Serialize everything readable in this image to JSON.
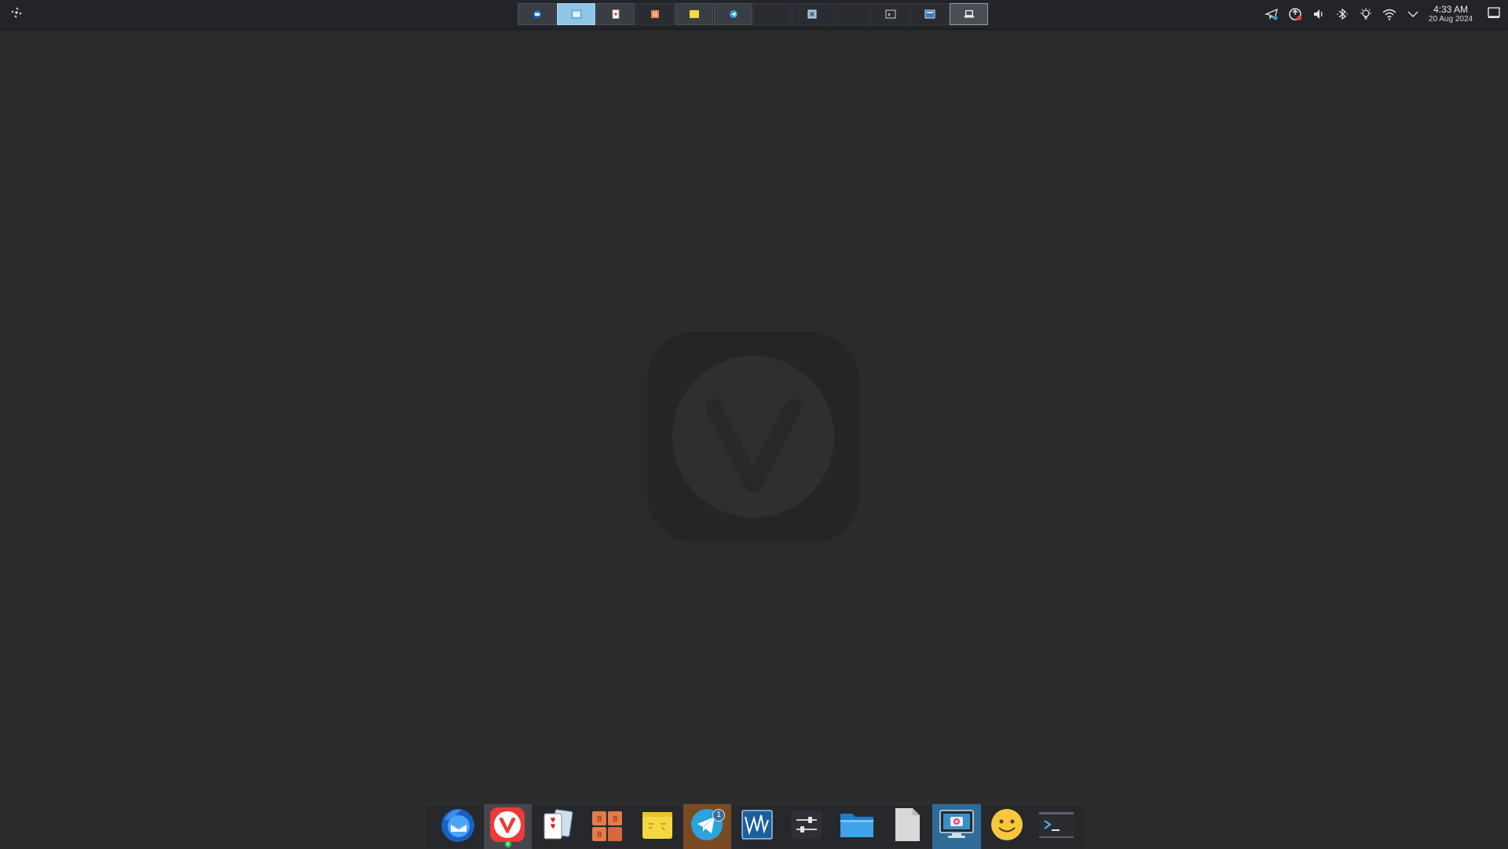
{
  "top_panel": {
    "launcher_icon": "launcher-arrows-icon",
    "virtual_desktops": [
      {
        "name": "desktop-1",
        "icon": "thunderbird-mini-icon",
        "state": "filled"
      },
      {
        "name": "desktop-2",
        "icon": "window-mini-icon",
        "state": "active"
      },
      {
        "name": "desktop-3",
        "icon": "cards-mini-icon",
        "state": "filled"
      },
      {
        "name": "desktop-4",
        "icon": "mahjong-mini-icon",
        "state": "empty"
      },
      {
        "name": "desktop-5",
        "icon": "notes-mini-icon",
        "state": "filled"
      },
      {
        "name": "desktop-6",
        "icon": "telegram-mini-icon",
        "state": "filled"
      },
      {
        "name": "desktop-7",
        "icon": "",
        "state": "empty"
      },
      {
        "name": "desktop-8",
        "icon": "app-mini-icon",
        "state": "empty"
      },
      {
        "name": "desktop-9",
        "icon": "",
        "state": "empty"
      },
      {
        "name": "desktop-10",
        "icon": "terminal-mini-icon",
        "state": "empty"
      },
      {
        "name": "desktop-11",
        "icon": "window-blue-mini-icon",
        "state": "empty"
      },
      {
        "name": "desktop-12",
        "icon": "laptop-mini-icon",
        "state": "current"
      }
    ],
    "tray_icons": [
      "telegram-tray-icon",
      "update-notifier-icon",
      "volume-icon",
      "bluetooth-icon",
      "brightness-icon",
      "wifi-icon",
      "expand-tray-icon"
    ],
    "clock": {
      "time": "4:33 AM",
      "date": "20 Aug 2024"
    },
    "show_desktop_icon": "show-desktop-icon"
  },
  "desktop": {
    "watermark_icon": "vivaldi-logo-icon"
  },
  "dock": {
    "items": [
      {
        "name": "thunderbird",
        "icon": "thunderbird-icon",
        "state": "normal"
      },
      {
        "name": "vivaldi",
        "icon": "vivaldi-icon",
        "state": "active"
      },
      {
        "name": "solitaire",
        "icon": "playing-cards-icon",
        "state": "normal"
      },
      {
        "name": "mahjongg",
        "icon": "mahjong-tiles-icon",
        "state": "normal"
      },
      {
        "name": "sticky-notes",
        "icon": "sticky-notes-icon",
        "state": "normal"
      },
      {
        "name": "telegram",
        "icon": "telegram-icon",
        "state": "hl-orange",
        "badge": "1"
      },
      {
        "name": "system-monitor",
        "icon": "system-monitor-icon",
        "state": "normal"
      },
      {
        "name": "settings",
        "icon": "settings-sliders-icon",
        "state": "normal"
      },
      {
        "name": "file-manager",
        "icon": "folder-icon",
        "state": "normal"
      },
      {
        "name": "text-document",
        "icon": "document-icon",
        "state": "normal"
      },
      {
        "name": "screenshot-tool",
        "icon": "screenshot-icon",
        "state": "hl-blue"
      },
      {
        "name": "emoji-picker",
        "icon": "smiley-icon",
        "state": "normal"
      },
      {
        "name": "terminal",
        "icon": "terminal-icon",
        "state": "normal"
      }
    ]
  },
  "colors": {
    "desktop_bg": "#2b2b2b",
    "panel_bg": "#222429",
    "accent_blue": "#8fc6ea",
    "vivaldi_red": "#ef3939",
    "telegram_blue": "#2aa3df"
  }
}
